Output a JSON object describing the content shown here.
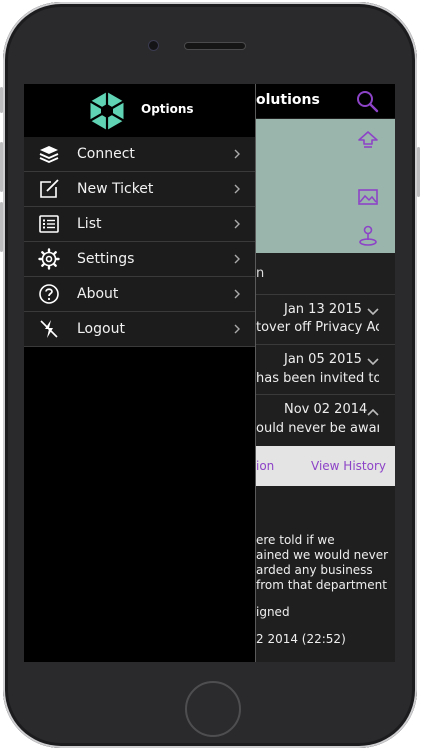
{
  "background_app": {
    "title_fragment": "olutions",
    "section_title_fragment": "n",
    "history": [
      {
        "date": "Jan 13 2015",
        "text": "tover off Privacy Ac...",
        "expanded": false
      },
      {
        "date": "Jan 05 2015",
        "text": "has been invited to ...",
        "expanded": false
      },
      {
        "date": "Nov 02 2014",
        "text": "ould never be awar...",
        "expanded": true
      }
    ],
    "action_fragment": "ion",
    "view_history_label": "View History",
    "detail_lines": [
      "ere told if we",
      "ained we would never",
      "arded any business",
      "from that department"
    ],
    "status_fragment": "igned",
    "timestamp_fragment": "2 2014 (22:52)"
  },
  "drawer": {
    "title": "Options",
    "items": [
      {
        "label": "Connect",
        "icon": "layers-icon"
      },
      {
        "label": "New Ticket",
        "icon": "edit-icon"
      },
      {
        "label": "List",
        "icon": "list-icon"
      },
      {
        "label": "Settings",
        "icon": "gear-icon"
      },
      {
        "label": "About",
        "icon": "help-icon"
      },
      {
        "label": "Logout",
        "icon": "logout-icon"
      }
    ]
  },
  "colors": {
    "accent": "#8d43c7",
    "logo_teal": "#5fd3b3",
    "panel_teal": "#9ab6ac"
  }
}
